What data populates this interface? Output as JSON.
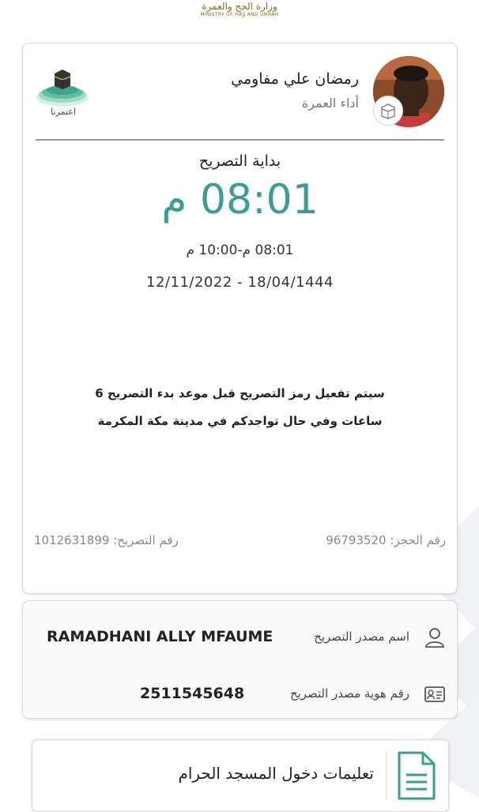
{
  "header": {
    "ministry_ar": "وزارة الحج والعمرة",
    "ministry_en": "MINISTRY OF HAJJ AND UMRAH"
  },
  "permit": {
    "pilgrim_name": "رمضان علي مفاومي",
    "permit_type": "أداء العمرة",
    "app_logo_text": "اعتمرنا",
    "start_label": "بداية التصريح",
    "start_time": "08:01 م",
    "time_range": "08:01 م-10:00 م",
    "date_range": "12/11/2022 - 18/04/1444",
    "notice_line1": "سيتم تفعيل رمز التصريح قبل موعد بدء التصريح 6",
    "notice_line2": "ساعات وفي حال تواجدكم في مدينة مكة المكرمة",
    "booking_label": "رقم الحجز:",
    "booking_value": "96793520",
    "permit_label": "رقم التصريح:",
    "permit_value": "1012631899"
  },
  "issuer": {
    "name_label": "اسم مصدر التصريح",
    "name_value": "RAMADHANI ALLY  MFAUME",
    "id_label": "رقم هوية مصدر التصريح",
    "id_value": "2511545648"
  },
  "instructions": {
    "title": "تعليمات دخول المسجد الحرام"
  },
  "icons": {
    "badge": "kaaba-icon",
    "issuer_name": "person-icon",
    "issuer_id": "id-card-icon",
    "instructions": "document-icon"
  },
  "colors": {
    "accent": "#3a9e92",
    "ministry": "#8a6d1e",
    "card_border": "#d9d9d9"
  }
}
